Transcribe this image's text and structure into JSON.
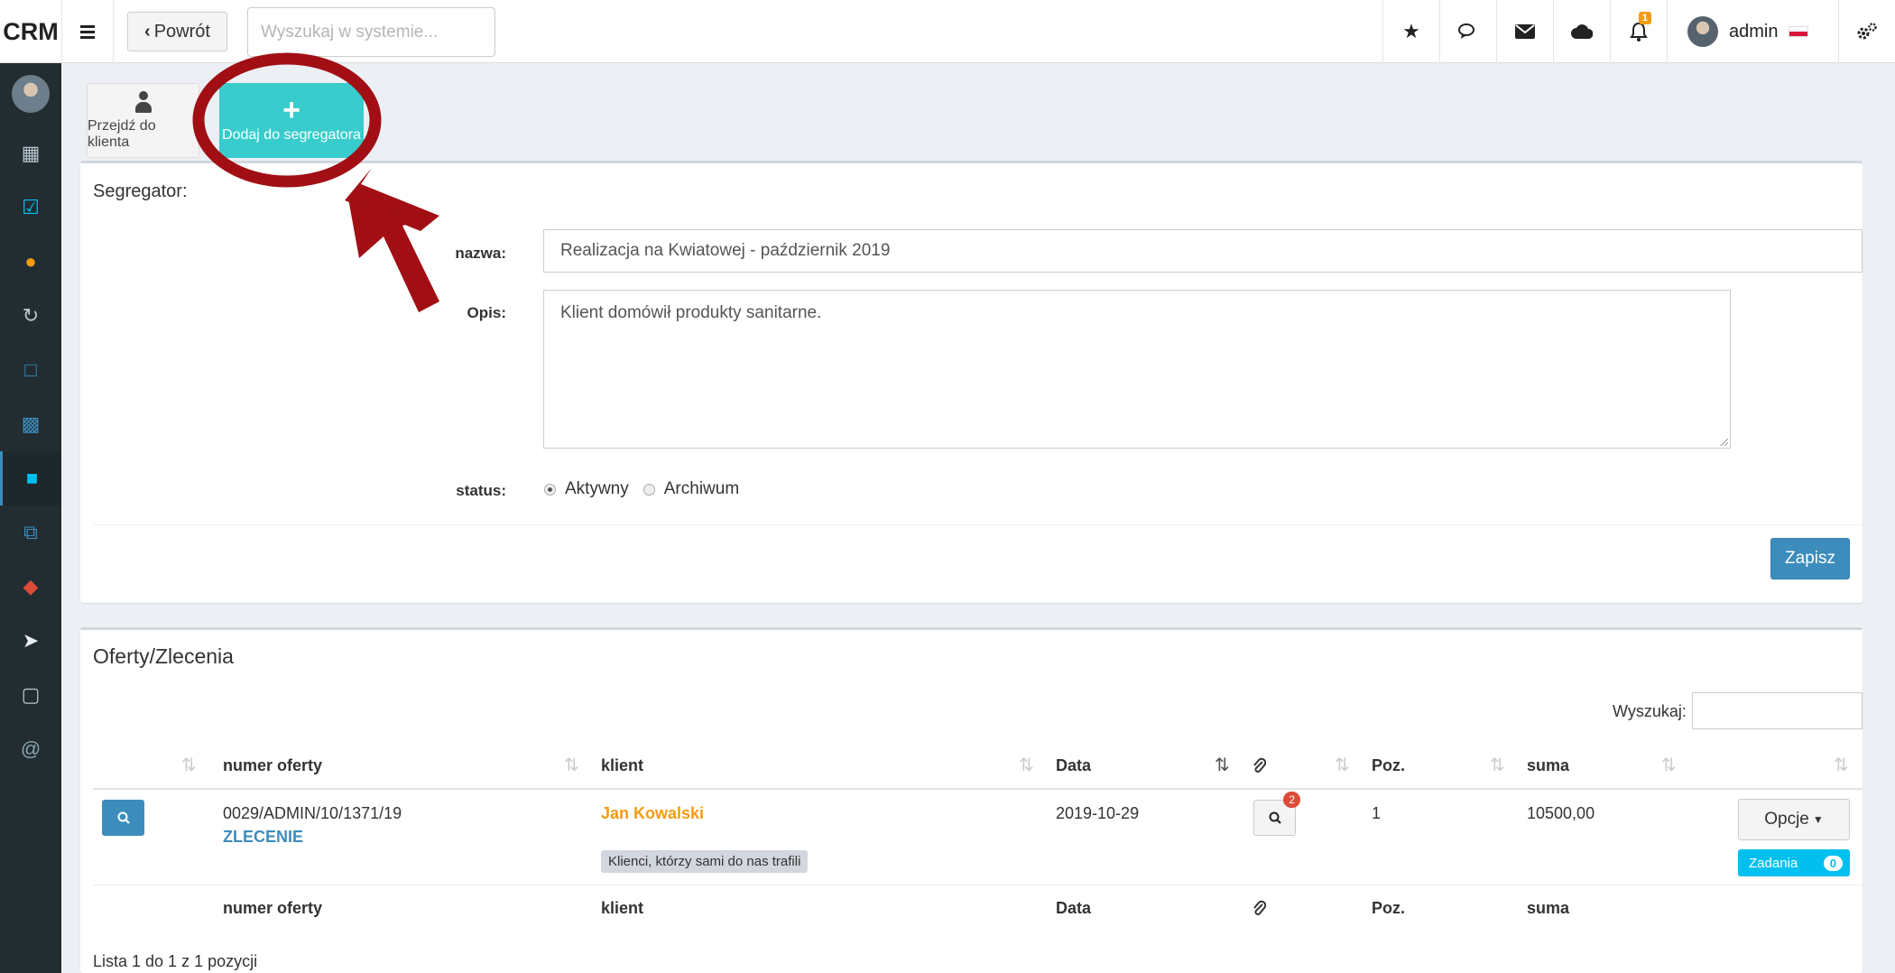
{
  "topbar": {
    "brand": "CRM",
    "back_label": "Powrót",
    "search_placeholder": "Wyszukaj w systemie...",
    "notification_count": "1",
    "user_name": "admin"
  },
  "sidebar": {
    "items": [
      {
        "icon": "calendar-icon",
        "color": "#b8c7ce"
      },
      {
        "icon": "calendar-check-icon",
        "color": "#00c0ef"
      },
      {
        "icon": "users-icon",
        "color": "#f39c12"
      },
      {
        "icon": "refresh-icon",
        "color": "#b8c7ce"
      },
      {
        "icon": "document-icon",
        "color": "#3c8dbc"
      },
      {
        "icon": "pdf-icon",
        "color": "#3c8dbc"
      },
      {
        "icon": "segregator-icon",
        "color": "#00c0ef"
      },
      {
        "icon": "copy-icon",
        "color": "#3c8dbc"
      },
      {
        "icon": "ticket-icon",
        "color": "#dd4b39"
      },
      {
        "icon": "send-icon",
        "color": "#ecf0f5"
      },
      {
        "icon": "note-icon",
        "color": "#b8c7ce"
      },
      {
        "icon": "at-icon",
        "color": "#8aa4af"
      }
    ]
  },
  "actions": {
    "goto_client": "Przejdź do klienta",
    "add_to_segregator": "Dodaj do segregatora"
  },
  "segregator": {
    "title": "Segregator:",
    "name_label": "nazwa:",
    "name_value": "Realizacja na Kwiatowej - październik 2019",
    "desc_label": "Opis:",
    "desc_value": "Klient domówił produkty sanitarne.",
    "status_label": "status:",
    "status_active": "Aktywny",
    "status_archive": "Archiwum",
    "save_label": "Zapisz"
  },
  "offers": {
    "title": "Oferty/Zlecenia",
    "search_label": "Wyszukaj:",
    "columns": [
      "numer oferty",
      "klient",
      "Data",
      "Poz.",
      "suma"
    ],
    "rows": [
      {
        "number": "0029/ADMIN/10/1371/19",
        "type": "ZLECENIE",
        "client": "Jan Kowalski",
        "client_tag": "Klienci, którzy sami do nas trafili",
        "date": "2019-10-29",
        "attachments": "2",
        "positions": "1",
        "sum": "10500,00",
        "options_label": "Opcje",
        "tasks_label": "Zadania",
        "tasks_count": "0"
      }
    ],
    "footer": "Lista 1 do 1 z 1 pozycji"
  },
  "colors": {
    "primary": "#3c8dbc",
    "teal": "#39cccc",
    "sidebar_bg": "#222d32",
    "annotation": "#a10f14"
  }
}
